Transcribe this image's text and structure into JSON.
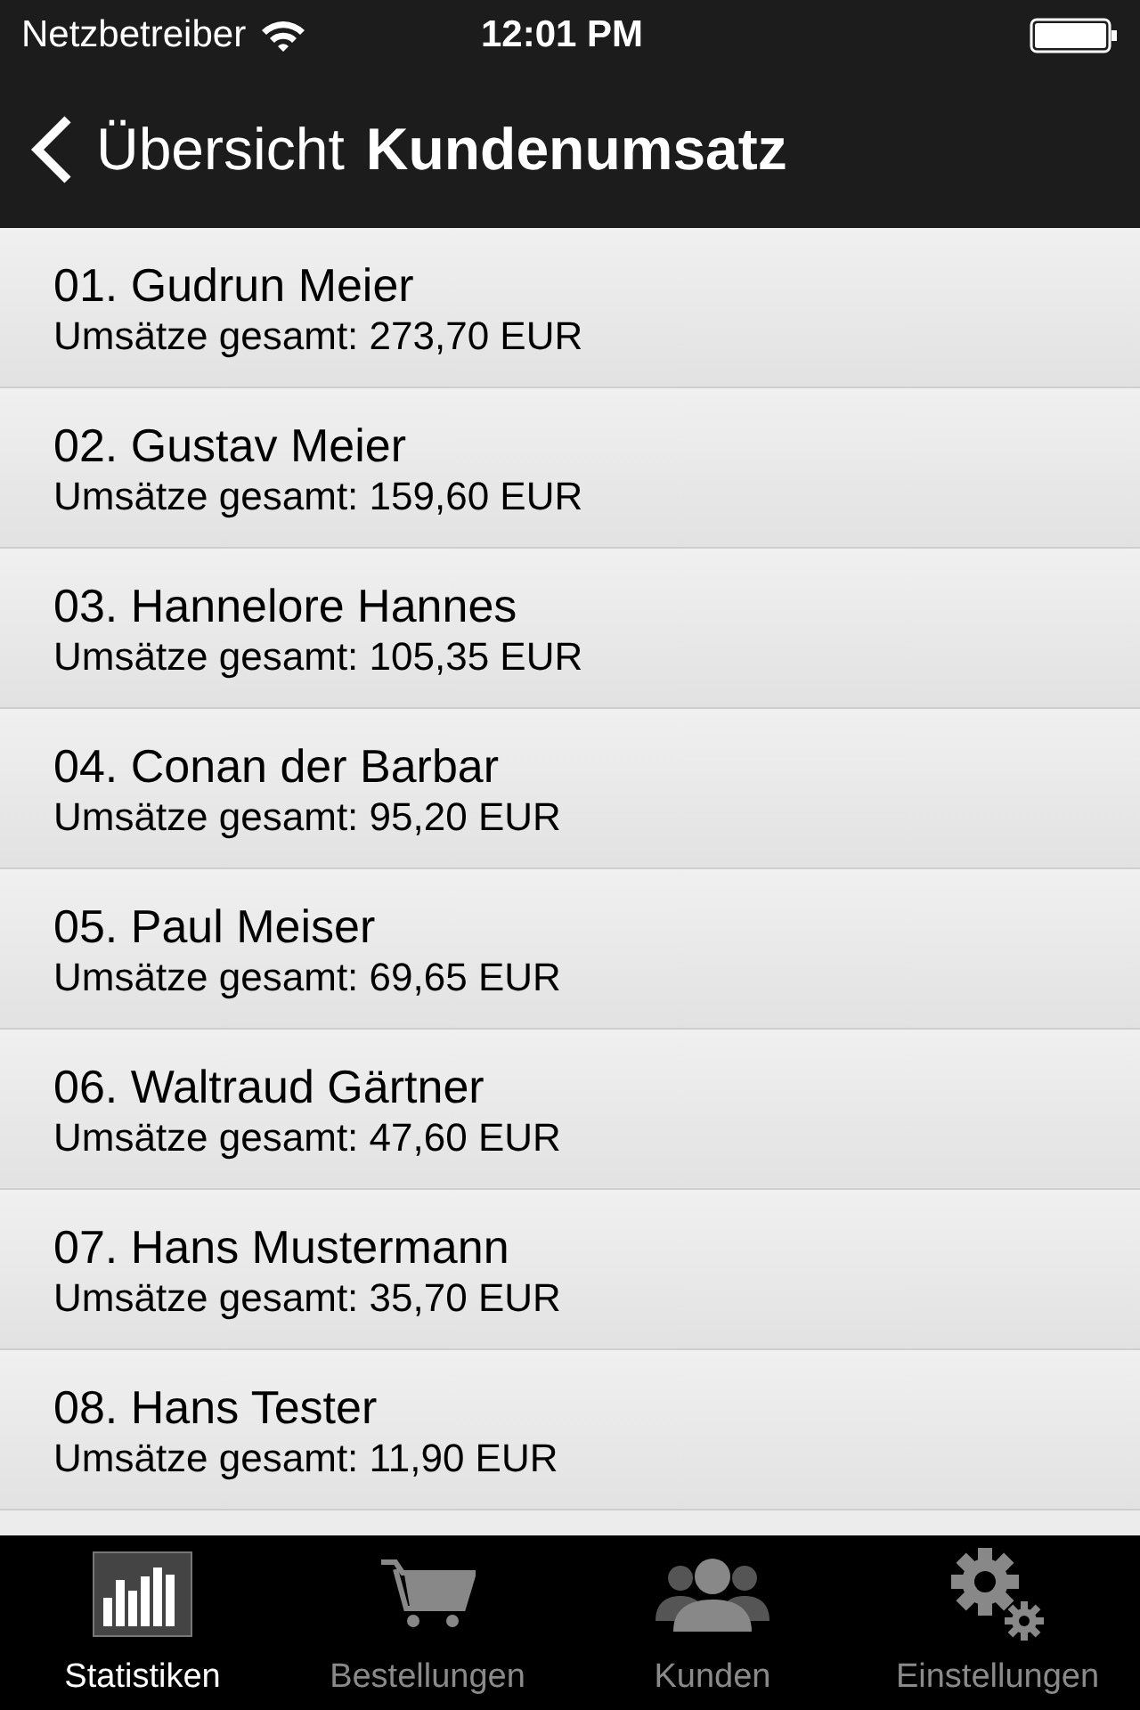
{
  "status_bar": {
    "carrier": "Netzbetreiber",
    "time": "12:01 PM"
  },
  "nav_bar": {
    "back": "Übersicht",
    "title": "Kundenumsatz"
  },
  "customers": [
    {
      "name": "01. Gudrun Meier",
      "total": "Umsätze gesamt: 273,70 EUR"
    },
    {
      "name": "02. Gustav Meier",
      "total": "Umsätze gesamt: 159,60 EUR"
    },
    {
      "name": "03. Hannelore Hannes",
      "total": "Umsätze gesamt: 105,35 EUR"
    },
    {
      "name": "04. Conan der Barbar",
      "total": "Umsätze gesamt: 95,20 EUR"
    },
    {
      "name": "05. Paul Meiser",
      "total": "Umsätze gesamt: 69,65 EUR"
    },
    {
      "name": "06. Waltraud Gärtner",
      "total": "Umsätze gesamt: 47,60 EUR"
    },
    {
      "name": "07. Hans Mustermann",
      "total": "Umsätze gesamt: 35,70 EUR"
    },
    {
      "name": "08. Hans Tester",
      "total": "Umsätze gesamt: 11,90 EUR"
    }
  ],
  "tab_bar": [
    {
      "kind": "chart",
      "label": "Statistiken",
      "selected": true
    },
    {
      "kind": "cart",
      "label": "Bestellungen",
      "selected": false
    },
    {
      "kind": "people",
      "label": "Kunden",
      "selected": false
    },
    {
      "kind": "gears",
      "label": "Einstellungen",
      "selected": false
    }
  ]
}
